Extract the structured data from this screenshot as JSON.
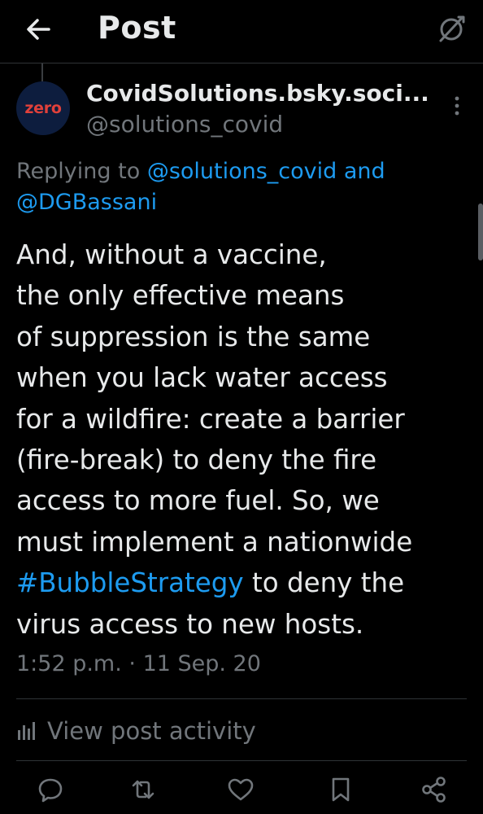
{
  "header": {
    "title": "Post",
    "back_icon": "arrow-left-icon",
    "status_icon": "slashed-circle-icon"
  },
  "author": {
    "display_name": "CovidSolutions.bsky.soci...",
    "handle": "@solutions_covid",
    "avatar_text": "zero",
    "avatar_bg": "#0d1d3e",
    "avatar_text_color": "#e0403a"
  },
  "reply": {
    "prefix": "Replying to ",
    "mention_1": "@solutions_covid",
    "conjunction": " and",
    "mention_2": "@DGBassani"
  },
  "post": {
    "lines": [
      "And, without a vaccine,",
      "the only effective means",
      "of suppression is the same",
      "when you lack water access",
      "for a wildfire: create a barrier",
      "(fire-break) to deny the fire",
      "access to more fuel. So, we",
      "must implement a nationwide"
    ],
    "hashtag": "#BubbleStrategy",
    "after_hashtag": " to deny the",
    "last_line": "virus access to new hosts."
  },
  "timestamp": "1:52 p.m. · 11 Sep. 20",
  "activity_label": "View post activity",
  "actions": [
    "reply-icon",
    "repost-icon",
    "like-icon",
    "bookmark-icon",
    "share-icon"
  ],
  "colors": {
    "background": "#000000",
    "text": "#e7e9ea",
    "secondary": "#71767b",
    "accent": "#1d9bf0",
    "divider": "#2f3336"
  }
}
